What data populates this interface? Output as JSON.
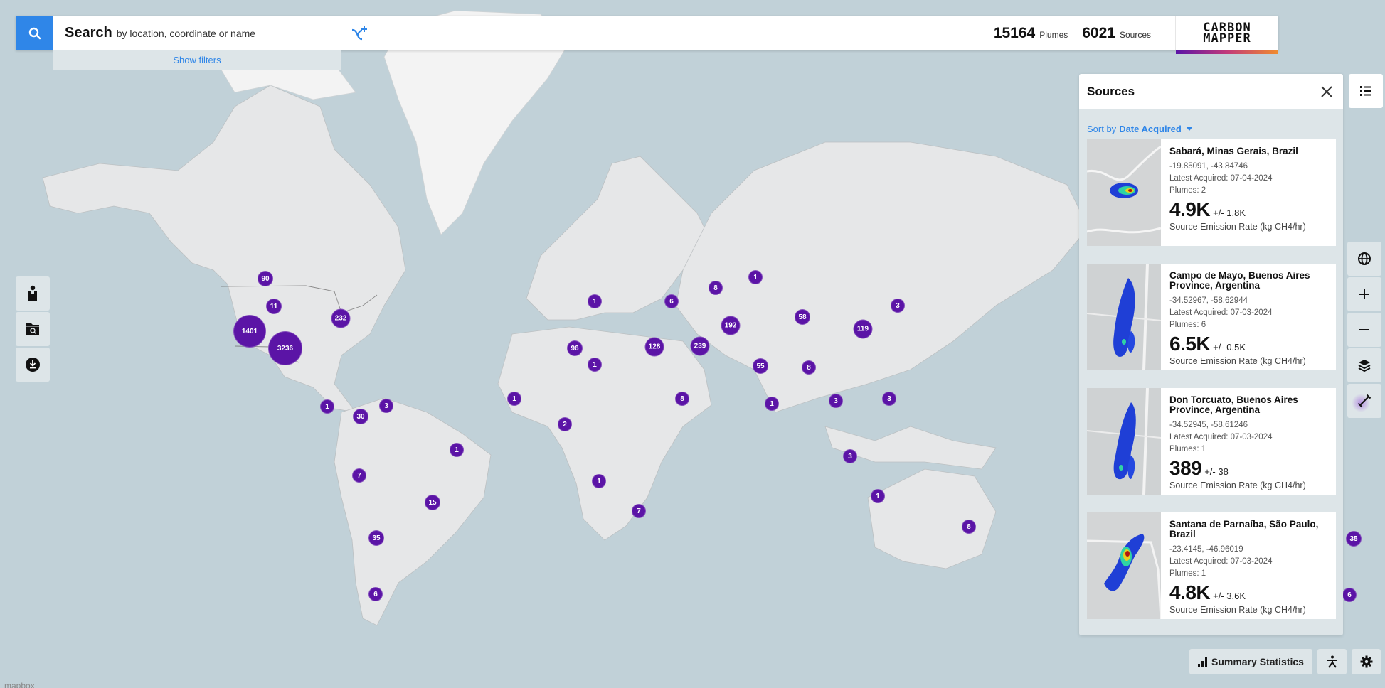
{
  "search": {
    "title": "Search",
    "hint": "by location, coordinate or name",
    "show_filters": "Show filters"
  },
  "counts": {
    "plumes_value": "15164",
    "plumes_label": "Plumes",
    "sources_value": "6021",
    "sources_label": "Sources"
  },
  "logo": {
    "line1": "CARBON",
    "line2": "MAPPER"
  },
  "panel": {
    "title": "Sources",
    "sort_label": "Sort by",
    "sort_value": "Date Acquired",
    "sources": [
      {
        "name": "Sabará, Minas Gerais, Brazil",
        "coords": "-19.85091, -43.84746",
        "acquired": "Latest Acquired: 07-04-2024",
        "plumes": "Plumes: 2",
        "rate": "4.9K",
        "uncertainty": "+/- 1.8K",
        "rate_label": "Source Emission Rate (kg CH4/hr)"
      },
      {
        "name": "Campo de Mayo, Buenos Aires Province, Argentina",
        "coords": "-34.52967, -58.62944",
        "acquired": "Latest Acquired: 07-03-2024",
        "plumes": "Plumes: 6",
        "rate": "6.5K",
        "uncertainty": "+/- 0.5K",
        "rate_label": "Source Emission Rate (kg CH4/hr)"
      },
      {
        "name": "Don Torcuato, Buenos Aires Province, Argentina",
        "coords": "-34.52945, -58.61246",
        "acquired": "Latest Acquired: 07-03-2024",
        "plumes": "Plumes: 1",
        "rate": "389",
        "uncertainty": "+/- 38",
        "rate_label": "Source Emission Rate (kg CH4/hr)"
      },
      {
        "name": "Santana de Parnaíba, São Paulo, Brazil",
        "coords": "-23.4145, -46.96019",
        "acquired": "Latest Acquired: 07-03-2024",
        "plumes": "Plumes: 1",
        "rate": "4.8K",
        "uncertainty": "+/- 3.6K",
        "rate_label": "Source Emission Rate (kg CH4/hr)"
      }
    ]
  },
  "bottom": {
    "summary_label": "Summary Statistics"
  },
  "map": {
    "attribution": "mapbox",
    "cluster_color": "#5b14a6",
    "clusters": [
      {
        "label": "90",
        "region": "western Canada"
      },
      {
        "label": "11",
        "region": "US Rockies"
      },
      {
        "label": "1401",
        "region": "California"
      },
      {
        "label": "3236",
        "region": "Texas / New Mexico"
      },
      {
        "label": "232",
        "region": "Ohio Valley"
      },
      {
        "label": "1",
        "region": "Central America"
      },
      {
        "label": "30",
        "region": "Colombia"
      },
      {
        "label": "3",
        "region": "Venezuela"
      },
      {
        "label": "1",
        "region": "NE Brazil"
      },
      {
        "label": "7",
        "region": "Peru"
      },
      {
        "label": "15",
        "region": "SE Brazil"
      },
      {
        "label": "35",
        "region": "Argentina"
      },
      {
        "label": "6",
        "region": "Patagonia"
      },
      {
        "label": "96",
        "region": "Algeria"
      },
      {
        "label": "1",
        "region": "Libya"
      },
      {
        "label": "1",
        "region": "Italy"
      },
      {
        "label": "1",
        "region": "Senegal"
      },
      {
        "label": "2",
        "region": "Nigeria"
      },
      {
        "label": "1",
        "region": "Angola"
      },
      {
        "label": "7",
        "region": "South Africa"
      },
      {
        "label": "6",
        "region": "Caucasus"
      },
      {
        "label": "8",
        "region": "Kazakhstan"
      },
      {
        "label": "1",
        "region": "Russia"
      },
      {
        "label": "128",
        "region": "Egypt"
      },
      {
        "label": "239",
        "region": "Persian Gulf"
      },
      {
        "label": "192",
        "region": "Turkmenistan"
      },
      {
        "label": "8",
        "region": "Horn of Africa"
      },
      {
        "label": "55",
        "region": "Pakistan / India"
      },
      {
        "label": "58",
        "region": "Western China"
      },
      {
        "label": "8",
        "region": "Bangladesh"
      },
      {
        "label": "119",
        "region": "Central China"
      },
      {
        "label": "3",
        "region": "NE China"
      },
      {
        "label": "1",
        "region": "South India"
      },
      {
        "label": "3",
        "region": "Thailand"
      },
      {
        "label": "3",
        "region": "Philippines"
      },
      {
        "label": "3",
        "region": "Java"
      },
      {
        "label": "1",
        "region": "Western Australia"
      },
      {
        "label": "8",
        "region": "SE Australia"
      },
      {
        "label": "35",
        "region": "Argentina (wrapped)"
      },
      {
        "label": "6",
        "region": "Patagonia (wrapped)"
      }
    ]
  }
}
